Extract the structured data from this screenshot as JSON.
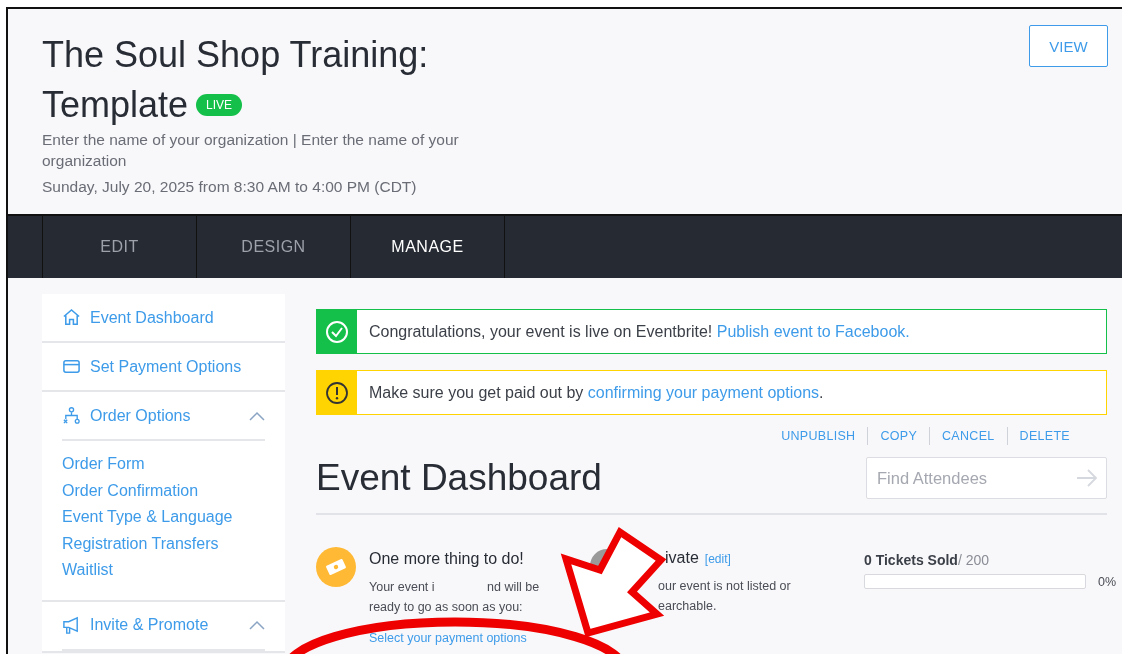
{
  "header": {
    "title_line1": "The Soul Shop Training:",
    "title_line2": "Template",
    "badge": "LIVE",
    "organizer": "Enter the name of your organization | Enter the name of your organization",
    "date": "Sunday, July 20, 2025 from 8:30 AM to 4:00 PM (CDT)",
    "view_button": "VIEW"
  },
  "tabs": [
    {
      "label": "EDIT",
      "selected": false
    },
    {
      "label": "DESIGN",
      "selected": false
    },
    {
      "label": "MANAGE",
      "selected": true
    }
  ],
  "sidebar": {
    "items": [
      {
        "label": "Event Dashboard",
        "kind": "home"
      },
      {
        "label": "Set Payment Options",
        "kind": "card"
      },
      {
        "label": "Order Options",
        "kind": "order",
        "expanded": true,
        "children": [
          {
            "label": "Order Form"
          },
          {
            "label": "Order Confirmation"
          },
          {
            "label": "Event Type & Language"
          },
          {
            "label": "Registration Transfers"
          },
          {
            "label": "Waitlist"
          }
        ]
      },
      {
        "label": "Invite & Promote",
        "kind": "promote",
        "expanded": true
      }
    ]
  },
  "banners": [
    {
      "kind": "success",
      "text": "Congratulations, your event is live on Eventbrite!",
      "link": "Publish event to Facebook."
    },
    {
      "kind": "warning",
      "text": "Make sure you get paid out by",
      "link": "confirming your payment options",
      "suffix": "."
    }
  ],
  "actions": [
    "UNPUBLISH",
    "COPY",
    "CANCEL",
    "DELETE"
  ],
  "dashboard_title": "Event Dashboard",
  "search": {
    "placeholder": "Find Attendees"
  },
  "todo": {
    "title": "One more thing to do!",
    "line1_start": "Your event i",
    "line1_end": "nd will be",
    "line2": "ready to go as soon as you:",
    "link": "Select your payment options"
  },
  "privacy": {
    "title": "ivate",
    "edit": "[edit]",
    "line1": "our event is not listed or",
    "line2": "earchable."
  },
  "tickets": {
    "sold": "0 Tickets Sold",
    "total": "/ 200",
    "level": 0,
    "percent": "0%"
  }
}
